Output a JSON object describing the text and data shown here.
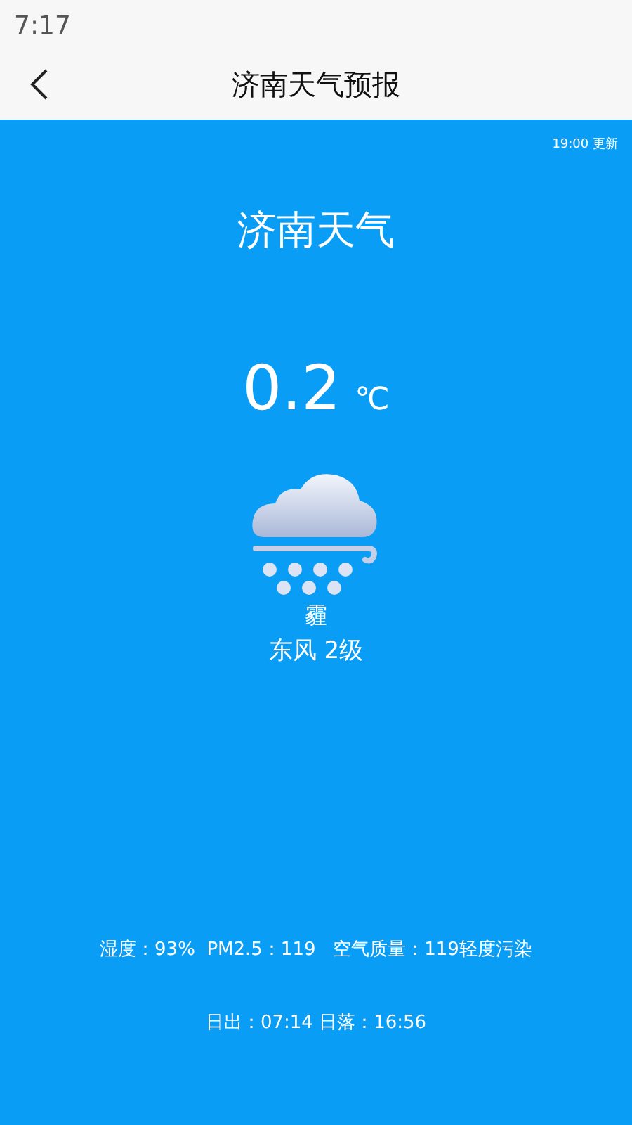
{
  "status_bar": {
    "time": "7:17"
  },
  "header": {
    "title": "济南天气预报"
  },
  "weather": {
    "updated": "19:00 更新",
    "city": "济南天气",
    "temperature": "0.2",
    "unit": "℃",
    "condition": "霾",
    "wind": "东风 2级",
    "stats": "湿度：93%  PM2.5：119   空气质量：119轻度污染",
    "sun": "日出：07:14 日落：16:56"
  }
}
